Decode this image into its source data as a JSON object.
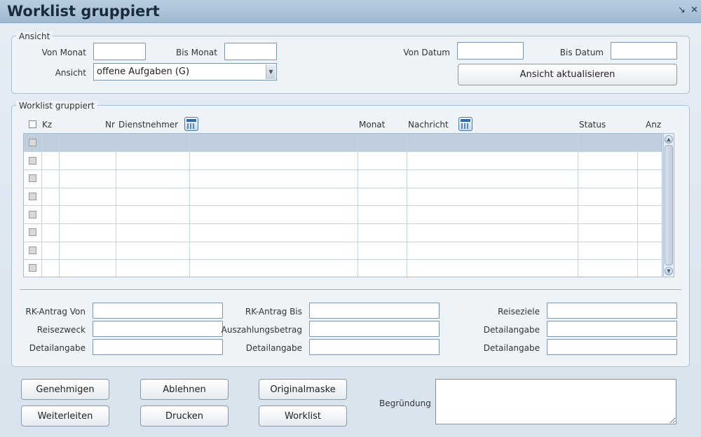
{
  "window": {
    "title": "Worklist gruppiert",
    "icons": [
      "minimize-icon",
      "close-icon"
    ]
  },
  "ansicht": {
    "legend": "Ansicht",
    "von_monat_label": "Von Monat",
    "von_monat_value": "",
    "bis_monat_label": "Bis Monat",
    "bis_monat_value": "",
    "von_datum_label": "Von Datum",
    "von_datum_value": "",
    "bis_datum_label": "Bis Datum",
    "bis_datum_value": "",
    "ansicht_label": "Ansicht",
    "ansicht_selected": "offene Aufgaben (G)",
    "refresh_button": "Ansicht aktualisieren"
  },
  "worklist": {
    "legend": "Worklist gruppiert",
    "columns": {
      "kz": "Kz",
      "nr": "Nr",
      "dienstnehmer": "Dienstnehmer",
      "monat": "Monat",
      "nachricht": "Nachricht",
      "status": "Status",
      "anz": "Anz"
    },
    "row_count": 8,
    "selected_row": 0
  },
  "details": {
    "rk_antrag_von_label": "RK-Antrag Von",
    "rk_antrag_bis_label": "RK-Antrag Bis",
    "reiseziele_label": "Reiseziele",
    "reisezweck_label": "Reisezweck",
    "auszahlungsbetrag_label": "Auszahlungsbetrag",
    "detailangabe_label": "Detailangabe"
  },
  "actions": {
    "genehmigen": "Genehmigen",
    "ablehnen": "Ablehnen",
    "originalmaske": "Originalmaske",
    "weiterleiten": "Weiterleiten",
    "drucken": "Drucken",
    "worklist": "Worklist",
    "begruendung_label": "Begründung"
  }
}
